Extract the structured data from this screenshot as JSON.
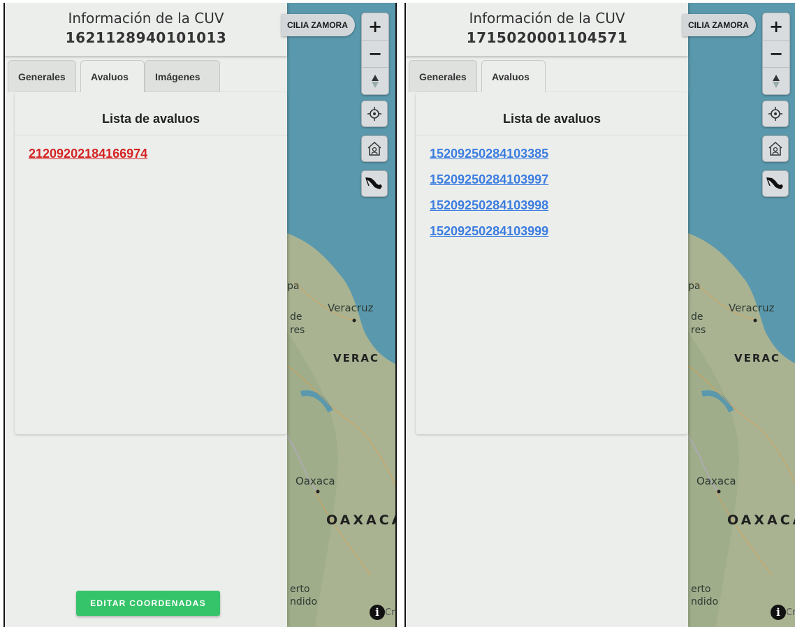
{
  "screens": {
    "left": {
      "panel_title": "Información de la CUV",
      "cuv": "1621128940101013",
      "tabs": [
        "Generales",
        "Avaluos",
        "Imágenes"
      ],
      "active_tab": "Avaluos",
      "list_title": "Lista de avaluos",
      "avaluos": [
        "21209202184166974"
      ],
      "link_color": "#d42323",
      "edit_button": "EDITAR COORDENADAS"
    },
    "right": {
      "panel_title": "Información de la CUV",
      "cuv": "1715020001104571",
      "tabs": [
        "Generales",
        "Avaluos"
      ],
      "active_tab": "Avaluos",
      "list_title": "Lista de avaluos",
      "avaluos": [
        "15209250284103385",
        "15209250284103997",
        "15209250284103998",
        "15209250284103999"
      ],
      "link_color": "#3c7de0"
    }
  },
  "map": {
    "user_chip": "CILIA ZAMORA",
    "labels": {
      "veracruz_city": "Veracruz",
      "veracruz_state": "VERAC",
      "oaxaca_city": "Oaxaca",
      "oaxaca_state": "OAXACA",
      "frag_pa": "pa",
      "frag_de": "de",
      "frag_res": "res",
      "frag_erto": "erto",
      "frag_ndido": "ndido",
      "frag_cr": "Cr"
    },
    "controls": {
      "zoom_in": "+",
      "zoom_out": "−",
      "info": "i"
    },
    "colors": {
      "water": "#5a99ad",
      "land": "#a9b392",
      "accent_green": "#36c46a"
    }
  }
}
